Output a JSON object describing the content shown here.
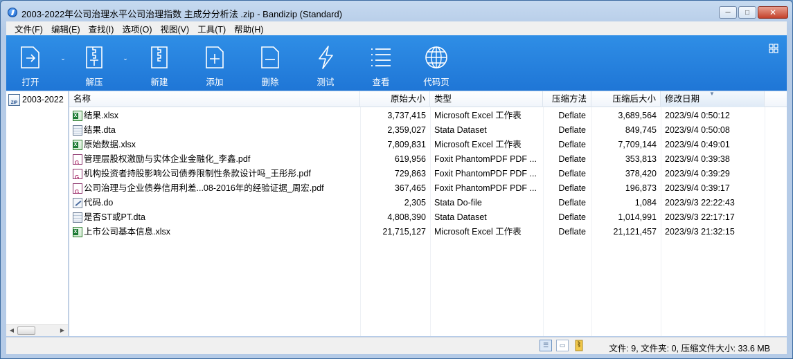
{
  "window": {
    "title": "2003-2022年公司治理水平公司治理指数 主成分分析法 .zip - Bandizip (Standard)",
    "buttons": {
      "minimize": "─",
      "maximize": "□",
      "close": "✕"
    }
  },
  "menu": [
    "文件(F)",
    "编辑(E)",
    "查找(I)",
    "选项(O)",
    "视图(V)",
    "工具(T)",
    "帮助(H)"
  ],
  "toolbar": {
    "open": "打开",
    "extract": "解压",
    "new": "新建",
    "add": "添加",
    "delete": "删除",
    "test": "测试",
    "view": "查看",
    "codepage": "代码页"
  },
  "tree": {
    "root_label": "2003-2022"
  },
  "columns": {
    "name": "名称",
    "size": "原始大小",
    "type": "类型",
    "method": "压缩方法",
    "packed": "压缩后大小",
    "modified": "修改日期"
  },
  "files": [
    {
      "icon": "excel",
      "name": "结果.xlsx",
      "size": "3,737,415",
      "type": "Microsoft Excel 工作表",
      "method": "Deflate",
      "packed": "3,689,564",
      "modified": "2023/9/4 0:50:12"
    },
    {
      "icon": "dta",
      "name": "结果.dta",
      "size": "2,359,027",
      "type": "Stata Dataset",
      "method": "Deflate",
      "packed": "849,745",
      "modified": "2023/9/4 0:50:08"
    },
    {
      "icon": "excel",
      "name": "原始数据.xlsx",
      "size": "7,809,831",
      "type": "Microsoft Excel 工作表",
      "method": "Deflate",
      "packed": "7,709,144",
      "modified": "2023/9/4 0:49:01"
    },
    {
      "icon": "pdf",
      "name": "管理层股权激励与实体企业金融化_李鑫.pdf",
      "size": "619,956",
      "type": "Foxit PhantomPDF PDF ...",
      "method": "Deflate",
      "packed": "353,813",
      "modified": "2023/9/4 0:39:38"
    },
    {
      "icon": "pdf",
      "name": "机构投资者持股影响公司债券限制性条款设计吗_王彤彤.pdf",
      "size": "729,863",
      "type": "Foxit PhantomPDF PDF ...",
      "method": "Deflate",
      "packed": "378,420",
      "modified": "2023/9/4 0:39:29"
    },
    {
      "icon": "pdf",
      "name": "公司治理与企业债券信用利差...08-2016年的经验证据_周宏.pdf",
      "size": "367,465",
      "type": "Foxit PhantomPDF PDF ...",
      "method": "Deflate",
      "packed": "196,873",
      "modified": "2023/9/4 0:39:17"
    },
    {
      "icon": "doc",
      "name": "代码.do",
      "size": "2,305",
      "type": "Stata Do-file",
      "method": "Deflate",
      "packed": "1,084",
      "modified": "2023/9/3 22:22:43"
    },
    {
      "icon": "dta",
      "name": "是否ST或PT.dta",
      "size": "4,808,390",
      "type": "Stata Dataset",
      "method": "Deflate",
      "packed": "1,014,991",
      "modified": "2023/9/3 22:17:17"
    },
    {
      "icon": "excel",
      "name": "上市公司基本信息.xlsx",
      "size": "21,715,127",
      "type": "Microsoft Excel 工作表",
      "method": "Deflate",
      "packed": "21,121,457",
      "modified": "2023/9/3 21:32:15"
    }
  ],
  "status": {
    "summary": "文件: 9, 文件夹: 0, 压缩文件大小: 33.6 MB"
  }
}
